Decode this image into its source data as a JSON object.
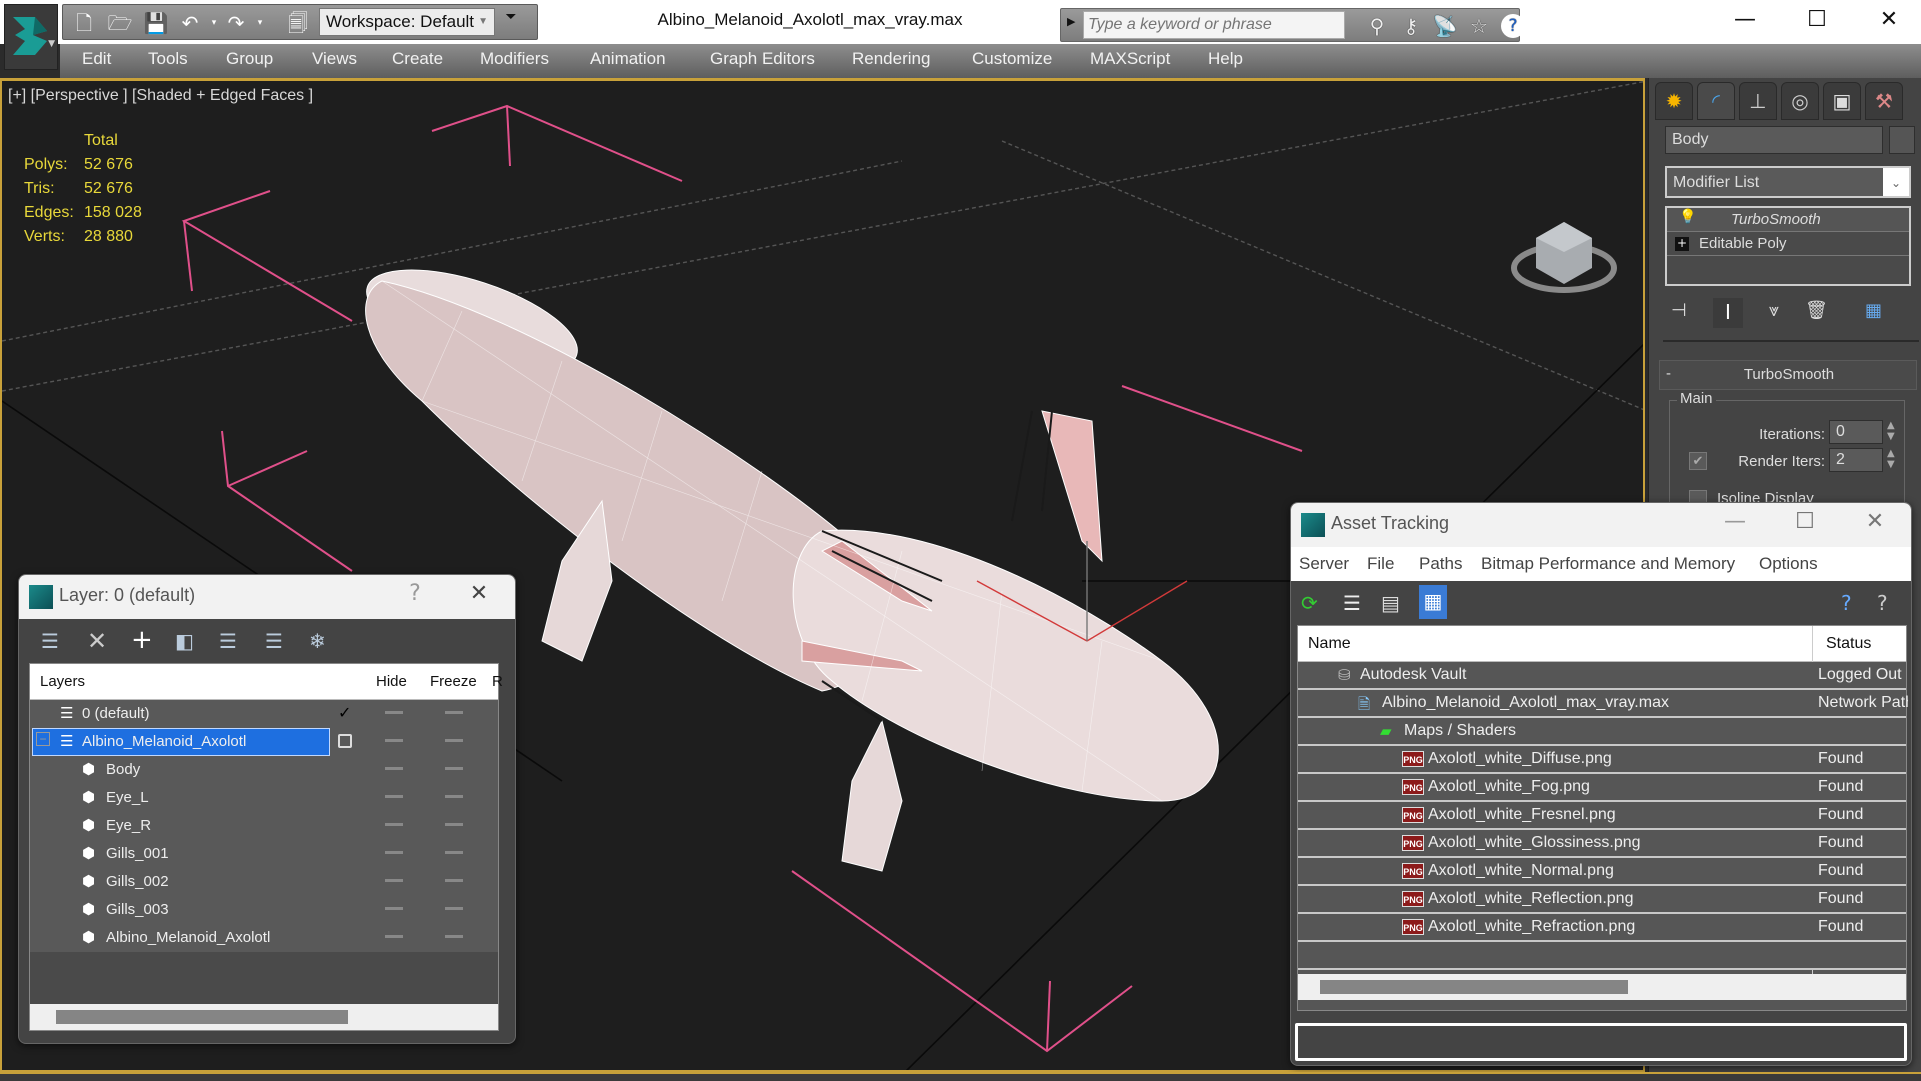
{
  "app": {
    "title": "Albino_Melanoid_Axolotl_max_vray.max",
    "workspace": "Workspace: Default",
    "search_placeholder": "Type a keyword or phrase",
    "quick_access_icons": [
      "new-file-icon",
      "open-folder-icon",
      "save-icon",
      "undo-icon",
      "redo-icon",
      "project-icon"
    ],
    "search_icons": [
      "binoculars-icon",
      "key-icon",
      "satellite-icon",
      "star-icon",
      "help-icon"
    ],
    "window_controls": [
      "minimize",
      "maximize",
      "close"
    ]
  },
  "menu": [
    "Edit",
    "Tools",
    "Group",
    "Views",
    "Create",
    "Modifiers",
    "Animation",
    "Graph Editors",
    "Rendering",
    "Customize",
    "MAXScript",
    "Help"
  ],
  "viewport": {
    "label": "[+] [Perspective ] [Shaded + Edged Faces ]",
    "stats": {
      "header": "Total",
      "rows": [
        {
          "label": "Polys:",
          "value": "52 676"
        },
        {
          "label": "Tris:",
          "value": "52 676"
        },
        {
          "label": "Edges:",
          "value": "158 028"
        },
        {
          "label": "Verts:",
          "value": "28 880"
        }
      ]
    }
  },
  "command_panel": {
    "tabs": [
      "create",
      "modify",
      "hierarchy",
      "motion",
      "display",
      "utilities"
    ],
    "object_name": "Body",
    "modifier_list": "Modifier List",
    "stack": [
      "TurboSmooth",
      "Editable Poly"
    ],
    "rollout": {
      "title": "TurboSmooth",
      "collapse": "-",
      "group": "Main",
      "iterations_label": "Iterations:",
      "iterations": "0",
      "render_iters_label": "Render Iters:",
      "render_iters": "2",
      "render_iters_checked": true,
      "isoline_label": "Isoline Display"
    }
  },
  "layer_dialog": {
    "title": "Layer: 0 (default)",
    "help": "?",
    "close": "✕",
    "columns": [
      "Layers",
      "",
      "Hide",
      "Freeze",
      "R"
    ],
    "rows": [
      {
        "name": "0 (default)",
        "type": "layer",
        "current": true,
        "level": 0
      },
      {
        "name": "Albino_Melanoid_Axolotl",
        "type": "layer",
        "selected": true,
        "level": 0,
        "expanded": true
      },
      {
        "name": "Body",
        "type": "object",
        "level": 1
      },
      {
        "name": "Eye_L",
        "type": "object",
        "level": 1
      },
      {
        "name": "Eye_R",
        "type": "object",
        "level": 1
      },
      {
        "name": "Gills_001",
        "type": "object",
        "level": 1
      },
      {
        "name": "Gills_002",
        "type": "object",
        "level": 1
      },
      {
        "name": "Gills_003",
        "type": "object",
        "level": 1
      },
      {
        "name": "Albino_Melanoid_Axolotl",
        "type": "object",
        "level": 1
      }
    ],
    "scroll_fraction": 0.62
  },
  "asset_dialog": {
    "title": "Asset Tracking",
    "menu": [
      "Server",
      "File",
      "Paths",
      "Bitmap Performance and Memory",
      "Options"
    ],
    "columns": [
      "Name",
      "Status"
    ],
    "rows": [
      {
        "name": "Autodesk Vault",
        "status": "Logged Out",
        "level": 0,
        "icon": "vault-icon"
      },
      {
        "name": "Albino_Melanoid_Axolotl_max_vray.max",
        "status": "Network Path",
        "level": 1,
        "icon": "max-file-icon"
      },
      {
        "name": "Maps / Shaders",
        "status": "",
        "level": 2,
        "icon": "maps-icon"
      },
      {
        "name": "Axolotl_white_Diffuse.png",
        "status": "Found",
        "level": 3,
        "icon": "png-icon"
      },
      {
        "name": "Axolotl_white_Fog.png",
        "status": "Found",
        "level": 3,
        "icon": "png-icon"
      },
      {
        "name": "Axolotl_white_Fresnel.png",
        "status": "Found",
        "level": 3,
        "icon": "png-icon"
      },
      {
        "name": "Axolotl_white_Glossiness.png",
        "status": "Found",
        "level": 3,
        "icon": "png-icon"
      },
      {
        "name": "Axolotl_white_Normal.png",
        "status": "Found",
        "level": 3,
        "icon": "png-icon"
      },
      {
        "name": "Axolotl_white_Reflection.png",
        "status": "Found",
        "level": 3,
        "icon": "png-icon"
      },
      {
        "name": "Axolotl_white_Refraction.png",
        "status": "Found",
        "level": 3,
        "icon": "png-icon"
      }
    ],
    "scroll_fraction": 0.6
  },
  "colors": {
    "viewport_border": "#c8a13a",
    "stats_text": "#e8d83a",
    "selection": "#1e6fe0",
    "gizmo_pink": "#e0508a"
  }
}
